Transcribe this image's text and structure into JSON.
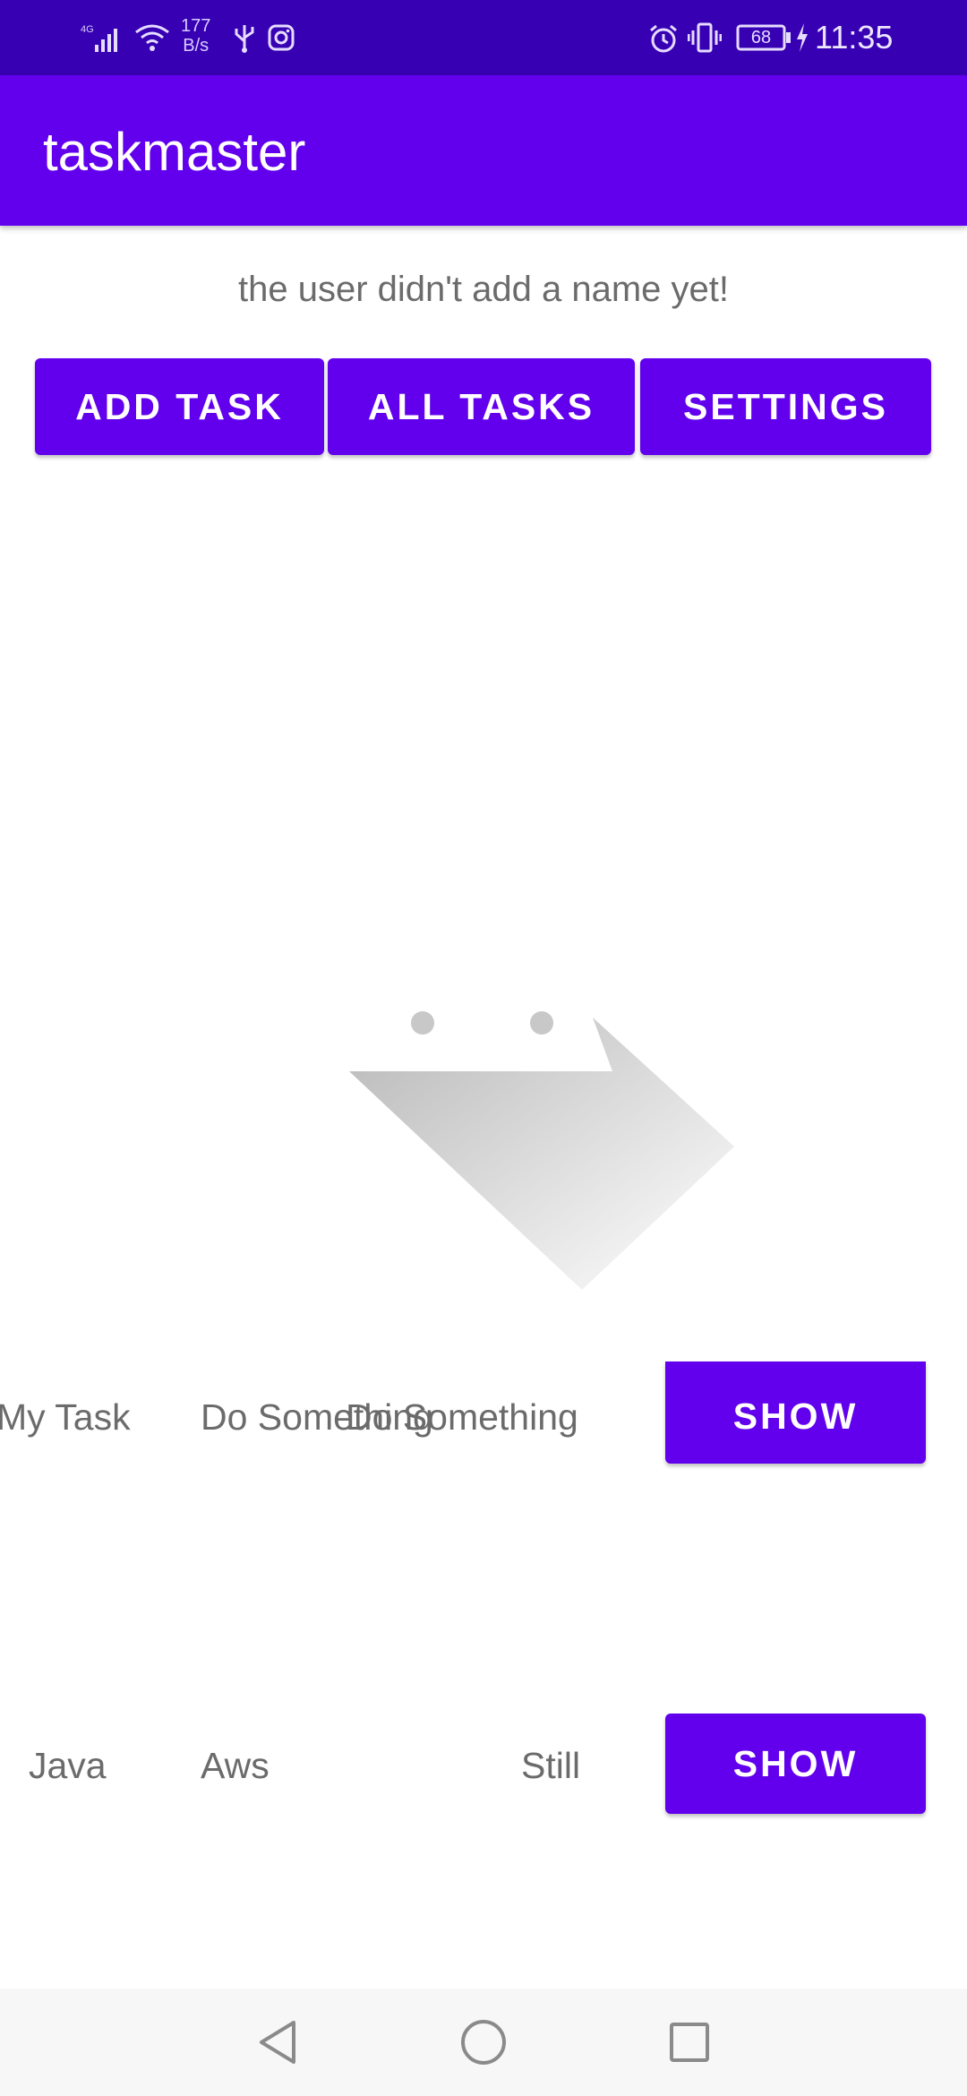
{
  "status_bar": {
    "network_speed_value": "177",
    "network_speed_unit": "B/s",
    "battery": "68",
    "time": "11:35",
    "icons": [
      "signal-icon",
      "wifi-icon",
      "usb-icon",
      "instagram-icon",
      "alarm-icon",
      "vibrate-icon",
      "battery-icon",
      "charging-icon"
    ]
  },
  "app_bar": {
    "title": "taskmaster"
  },
  "main": {
    "username_text": "the user didn't add a name yet!",
    "buttons": {
      "add_task": "ADD TASK",
      "all_tasks": "ALL TASKS",
      "settings": "SETTINGS"
    }
  },
  "tasks": [
    {
      "title": "My Task",
      "body": "Do Something",
      "state": "Do Something",
      "button": "SHOW"
    },
    {
      "title": "Java",
      "body": "Aws",
      "state": "Still",
      "button": "SHOW"
    }
  ],
  "nav_bar": {
    "icons": [
      "back-icon",
      "home-icon",
      "recents-icon"
    ]
  },
  "colors": {
    "status_bar": "#3700b3",
    "primary": "#6200ee",
    "text_secondary": "#6b6b6b",
    "nav_bar": "#f7f7f7"
  }
}
